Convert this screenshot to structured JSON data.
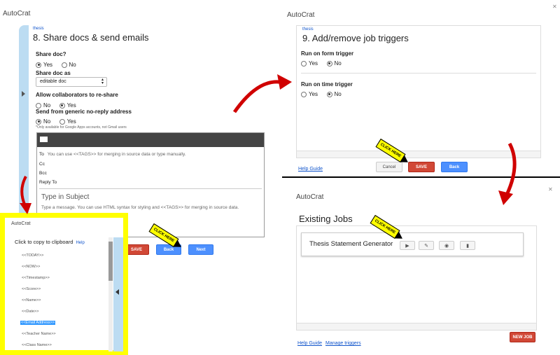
{
  "app_name": "AutoCrat",
  "step8": {
    "crumb": "thesis",
    "title": "8. Share docs & send emails",
    "share_doc_label": "Share doc?",
    "yes": "Yes",
    "no": "No",
    "share_as_label": "Share doc as",
    "share_as_value": "editable doc",
    "allow_label": "Allow collaborators to re-share",
    "noreply_label": "Send from generic no-reply address",
    "note": "*Only available for Google Apps accounts, not Gmail users",
    "email": {
      "to_label": "To",
      "to_hint": "You can use <<TAGS>> for merging in source data or type manually.",
      "cc": "Cc",
      "bcc": "Bcc",
      "reply_to": "Reply To",
      "subject": "Type in Subject",
      "message": "Type a message. You can use HTML syntax for styling and <<TAGS>> for merging in source data."
    },
    "save": "SAVE",
    "back": "Back",
    "next": "Next"
  },
  "clipboard": {
    "app": "AutoCrat",
    "title": "Click to copy to clipboard",
    "help": "Help",
    "tags": [
      "<<TODAY>>",
      "<<NOW>>",
      "<<Timestamp>>",
      "<<Score>>",
      "<<Name>>",
      "<<Date>>",
      "<<Email Address>>",
      "<<Teacher Name>>",
      "<<Class Name>>"
    ]
  },
  "step9": {
    "crumb": "thesis",
    "title": "9. Add/remove job triggers",
    "form_trigger": "Run on form trigger",
    "time_trigger": "Run on time trigger",
    "yes": "Yes",
    "no": "No",
    "help": "Help Guide",
    "cancel": "Cancel",
    "save": "SAVE",
    "back": "Back"
  },
  "jobs": {
    "title": "Existing Jobs",
    "job_name": "Thesis Statement Generator",
    "help": "Help Guide",
    "manage": "Manage triggers",
    "new_job": "NEW JOB"
  },
  "click_here": "CLICK HERE"
}
